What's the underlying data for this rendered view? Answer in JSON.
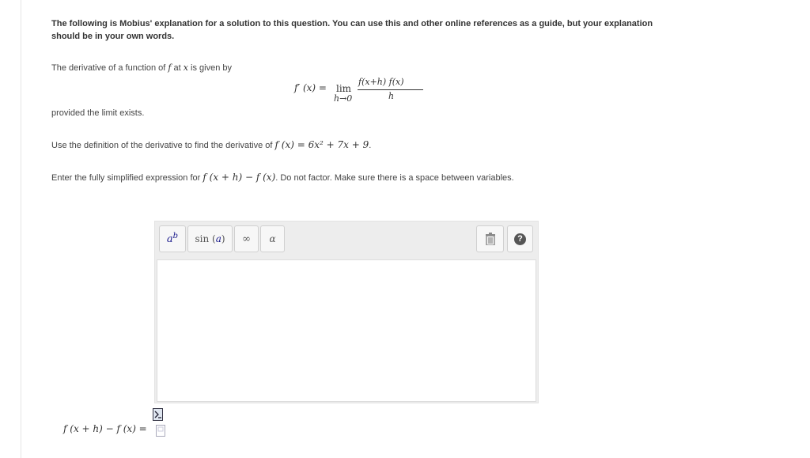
{
  "intro": "The following is Mobius' explanation for a solution to this question. You can use this and other online references as a guide, but your explanation should be in your own words.",
  "definition": {
    "lead": "The derivative of a function of",
    "f": "f",
    "at": "at",
    "x": "x",
    "tail": "is given by"
  },
  "formula": {
    "lhs": "f′ (x) =",
    "lim": "lim",
    "limsub": "h→0",
    "numerator": "f(x+h)  f(x)",
    "denominator": "h"
  },
  "provided": "provided the limit exists.",
  "instruction1": {
    "text": "Use the definition of the derivative to find the derivative of",
    "expr": "f (x) = 6x² + 7x + 9",
    "end": "."
  },
  "instruction2": {
    "text": "Enter the fully simplified expression for",
    "expr": "f (x + h) − f (x)",
    "tail": ". Do not factor. Make sure there is a space between variables."
  },
  "toolbar": {
    "ab_base": "a",
    "ab_exp": "b",
    "sin_label": "sin",
    "sin_arg": "a",
    "inf_label": "∞",
    "alpha_label": "α"
  },
  "answer": {
    "expr": "f (x + h) − f (x) ="
  },
  "icons": {
    "trash": "trash-icon",
    "help": "help-icon",
    "help_glyph": "?",
    "preview": "preview-icon",
    "blank": "blank-answer-icon"
  }
}
